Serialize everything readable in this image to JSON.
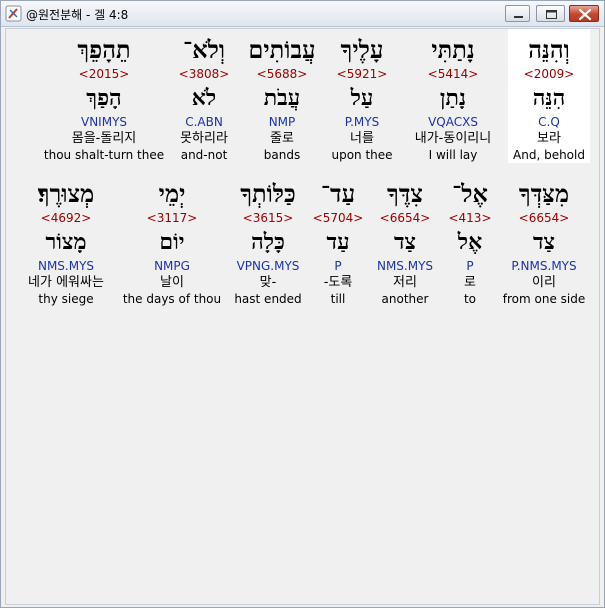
{
  "window": {
    "title": "@원전분해 - 겔 4:8"
  },
  "colors": {
    "strong_number": "#a00000",
    "morphology": "#1a32b0",
    "highlight": "#ffffff"
  },
  "rows": [
    {
      "words": [
        {
          "hebrew": "וְהִנֵּה",
          "strong": "<2009>",
          "lemma": "הִנֵּה",
          "morph": "C.Q",
          "korean": "보라",
          "english": "And, behold",
          "selected": true
        },
        {
          "hebrew": "נָתַתִּי",
          "strong": "<5414>",
          "lemma": "נָתַן",
          "morph": "VQACXS",
          "korean": "내가-동이리니",
          "english": "I will lay",
          "selected": false
        },
        {
          "hebrew": "עָלֶיךָ",
          "strong": "<5921>",
          "lemma": "עַל",
          "morph": "P.MYS",
          "korean": "너를",
          "english": "upon thee",
          "selected": false
        },
        {
          "hebrew": "עֲבוֹתִים",
          "strong": "<5688>",
          "lemma": "עֲבֹת",
          "morph": "NMP",
          "korean": "줄로",
          "english": "bands",
          "selected": false
        },
        {
          "hebrew": "וְלֹא־",
          "strong": "<3808>",
          "lemma": "לֹא",
          "morph": "C.ABN",
          "korean": "못하리라",
          "english": "and-not",
          "selected": false
        },
        {
          "hebrew": "תֵהָפֵךְ",
          "strong": "<2015>",
          "lemma": "הָפַךְ",
          "morph": "VNIMYS",
          "korean": "몸을-돌리지",
          "english": "thou shalt-turn thee",
          "selected": false
        }
      ]
    },
    {
      "words": [
        {
          "hebrew": "מִצַּדְּךָ",
          "strong": "<6654>",
          "lemma": "צַד",
          "morph": "P.NMS.MYS",
          "korean": "이리",
          "english": "from one side",
          "selected": false
        },
        {
          "hebrew": "אֶל־",
          "strong": "<413>",
          "lemma": "אֶל",
          "morph": "P",
          "korean": "로",
          "english": "to",
          "selected": false
        },
        {
          "hebrew": "צִדֶּךָ",
          "strong": "<6654>",
          "lemma": "צַד",
          "morph": "NMS.MYS",
          "korean": "저리",
          "english": "another",
          "selected": false
        },
        {
          "hebrew": "עַד־",
          "strong": "<5704>",
          "lemma": "עַד",
          "morph": "P",
          "korean": "-도록",
          "english": "till",
          "selected": false
        },
        {
          "hebrew": "כַּלּוֹתְךָ",
          "strong": "<3615>",
          "lemma": "כָּלָה",
          "morph": "VPNG.MYS",
          "korean": "맞-",
          "english": "hast ended",
          "selected": false
        },
        {
          "hebrew": "יְמֵי",
          "strong": "<3117>",
          "lemma": "יוֹם",
          "morph": "NMPG",
          "korean": "날이",
          "english": "the days of thou",
          "selected": false
        },
        {
          "hebrew": "מְצוּרֶךָ׃",
          "strong": "<4692>",
          "lemma": "מָצוֹר",
          "morph": "NMS.MYS",
          "korean": "네가 에워싸는",
          "english": "thy siege",
          "selected": false
        }
      ]
    }
  ]
}
